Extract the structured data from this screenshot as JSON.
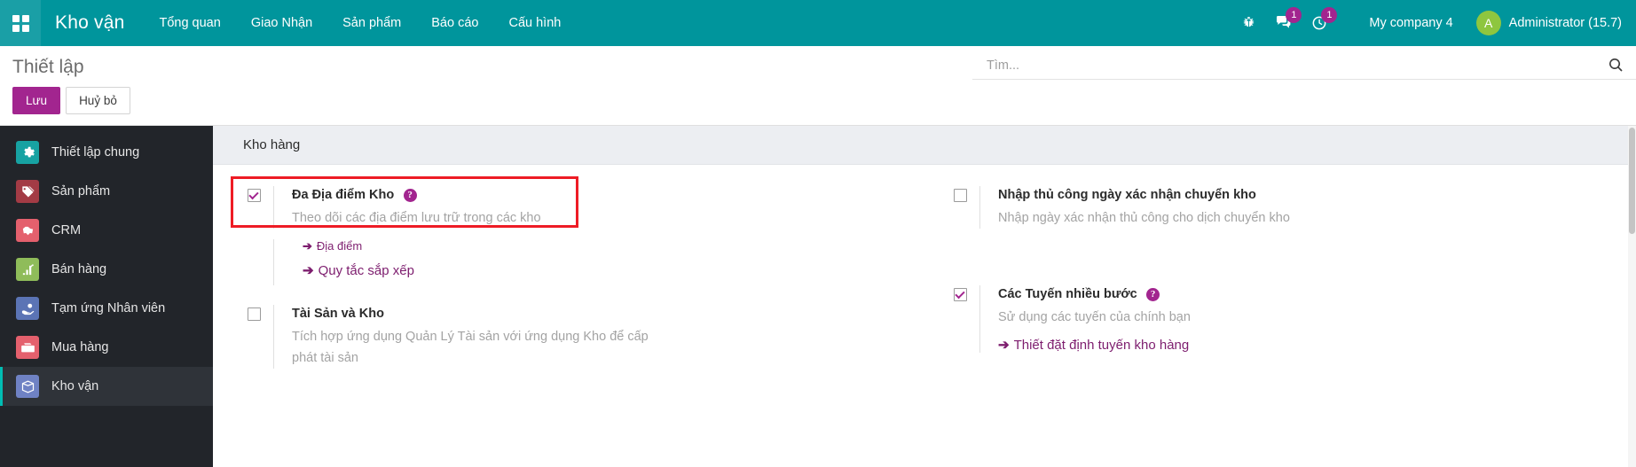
{
  "navbar": {
    "apps_icon": "grid-apps-icon",
    "brand": "Kho vận",
    "menu": [
      {
        "label": "Tổng quan"
      },
      {
        "label": "Giao Nhận"
      },
      {
        "label": "Sản phẩm"
      },
      {
        "label": "Báo cáo"
      },
      {
        "label": "Cấu hình"
      }
    ],
    "sys_icons": [
      {
        "name": "bug-icon",
        "badge": null
      },
      {
        "name": "messages-icon",
        "badge": "1"
      },
      {
        "name": "activities-clock-icon",
        "badge": "1"
      }
    ],
    "company": "My company 4",
    "user": {
      "initial": "A",
      "name": "Administrator (15.7)"
    },
    "colors": {
      "bar": "#00959c",
      "badge": "#a2258f",
      "avatar": "#8ec63f"
    }
  },
  "control_panel": {
    "title": "Thiết lập",
    "save_label": "Lưu",
    "discard_label": "Huỷ bỏ",
    "save_color": "#a2258f",
    "search": {
      "placeholder": "Tìm...",
      "value": "",
      "icon": "search-icon"
    }
  },
  "sidebar": {
    "items": [
      {
        "label": "Thiết lập chung",
        "icon": "gear-icon",
        "color": "#17a2a2",
        "active": false
      },
      {
        "label": "Sản phẩm",
        "icon": "tags-icon",
        "color": "#a33b45",
        "active": false
      },
      {
        "label": "CRM",
        "icon": "handshake-icon",
        "color": "#e4606d",
        "active": false
      },
      {
        "label": "Bán hàng",
        "icon": "bar-chart-icon",
        "color": "#8fbc5a",
        "active": false
      },
      {
        "label": "Tạm ứng Nhân viên",
        "icon": "hand-coin-icon",
        "color": "#5b74b5",
        "active": false
      },
      {
        "label": "Mua hàng",
        "icon": "cart-card-icon",
        "color": "#e4606d",
        "active": false
      },
      {
        "label": "Kho vận",
        "icon": "box-icon",
        "color": "#6f82c4",
        "active": true
      }
    ]
  },
  "main": {
    "section_title": "Kho hàng",
    "settings": [
      {
        "column": "left",
        "checked": true,
        "highlighted": true,
        "title": "Đa Địa điểm Kho",
        "has_help": true,
        "description": "Theo dõi các địa điểm lưu trữ trong các kho",
        "links": [
          {
            "label": "Địa điểm",
            "size": "small"
          },
          {
            "label": "Quy tắc sắp xếp",
            "size": "big"
          }
        ]
      },
      {
        "column": "right",
        "checked": false,
        "highlighted": false,
        "title": "Nhập thủ công ngày xác nhận chuyển kho",
        "has_help": false,
        "description": "Nhập ngày xác nhận thủ công cho dịch chuyển kho",
        "links": []
      },
      {
        "column": "left",
        "checked": false,
        "highlighted": false,
        "title": "Tài Sản và Kho",
        "has_help": false,
        "description": "Tích hợp ứng dụng Quản Lý Tài sản với ứng dụng Kho để cấp phát tài sản",
        "links": []
      },
      {
        "column": "right",
        "checked": true,
        "highlighted": false,
        "title": "Các Tuyến nhiều bước",
        "has_help": true,
        "description": "Sử dụng các tuyến của chính bạn",
        "links": [
          {
            "label": "Thiết đặt định tuyến kho hàng",
            "size": "big"
          }
        ]
      }
    ],
    "annotation": {
      "color": "#ee1c25",
      "target": "Đa Địa điểm Kho"
    }
  }
}
